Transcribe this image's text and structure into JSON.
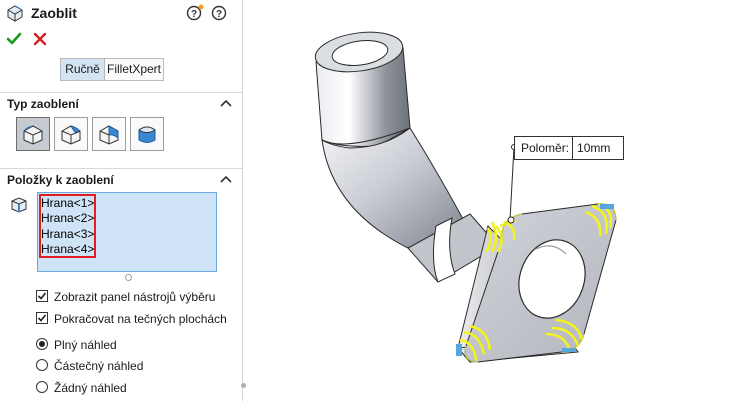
{
  "panel": {
    "title": "Zaoblit",
    "tabs": [
      "Ručně",
      "FilletXpert"
    ],
    "fillet_type_section": "Typ zaoblení",
    "fillet_items_section": "Položky k zaoblení",
    "edges": [
      "Hrana<1>",
      "Hrana<2>",
      "Hrana<3>",
      "Hrana<4>"
    ],
    "checkboxes": [
      {
        "label": "Zobrazit panel nástrojů výběru",
        "checked": true
      },
      {
        "label": "Pokračovat na tečných plochách",
        "checked": true
      }
    ],
    "radios": [
      {
        "label": "Plný náhled",
        "selected": true
      },
      {
        "label": "Částečný náhled",
        "selected": false
      },
      {
        "label": "Žádný náhled",
        "selected": false
      }
    ],
    "icons": [
      "fillet-feature-icon",
      "help-icon",
      "whats-new-help-icon",
      "ok-check-icon",
      "cancel-x-icon",
      "chevron-up-icon",
      "edge-selection-icon"
    ]
  },
  "viewport": {
    "callout_label": "Poloměr:",
    "callout_value": "10mm"
  },
  "colors": {
    "accent_blue": "#6fa8dc",
    "list_bg": "#cfe3f7",
    "highlight_red": "#e02020",
    "ok_green": "#1a9a1a",
    "cancel_red": "#d02020",
    "fillet_yellow": "#f2f21e"
  }
}
